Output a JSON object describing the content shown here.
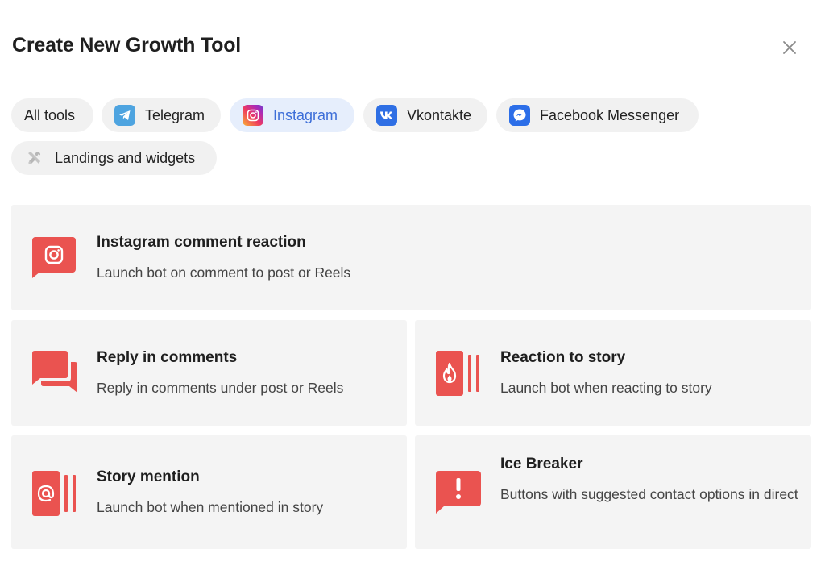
{
  "dialog": {
    "title": "Create New Growth Tool"
  },
  "filters": [
    {
      "label": "All tools",
      "icon": "",
      "active": false
    },
    {
      "label": "Telegram",
      "icon": "telegram-icon",
      "active": false
    },
    {
      "label": "Instagram",
      "icon": "instagram-icon",
      "active": true
    },
    {
      "label": "Vkontakte",
      "icon": "vk-icon",
      "active": false
    },
    {
      "label": "Facebook Messenger",
      "icon": "messenger-icon",
      "active": false
    },
    {
      "label": "Landings and widgets",
      "icon": "tools-icon",
      "active": false
    }
  ],
  "tools": [
    {
      "title": "Instagram comment reaction",
      "description": "Launch bot on comment to post or Reels",
      "icon": "instagram-bubble-icon"
    },
    {
      "title": "Reply in comments",
      "description": "Reply in comments under post or Reels",
      "icon": "chat-bubbles-icon"
    },
    {
      "title": "Reaction to story",
      "description": "Launch bot when reacting to story",
      "icon": "story-fire-icon"
    },
    {
      "title": "Story mention",
      "description": "Launch bot when mentioned in story",
      "icon": "story-mention-icon"
    },
    {
      "title": "Ice Breaker",
      "description": "Buttons with suggested contact options in direct",
      "icon": "exclamation-bubble-icon"
    }
  ],
  "colors": {
    "accent": "#ea5350",
    "active_chip_bg": "#e6eefc",
    "active_chip_text": "#3d6ed8",
    "card_bg": "#f4f4f4",
    "chip_bg": "#f1f1f1"
  }
}
